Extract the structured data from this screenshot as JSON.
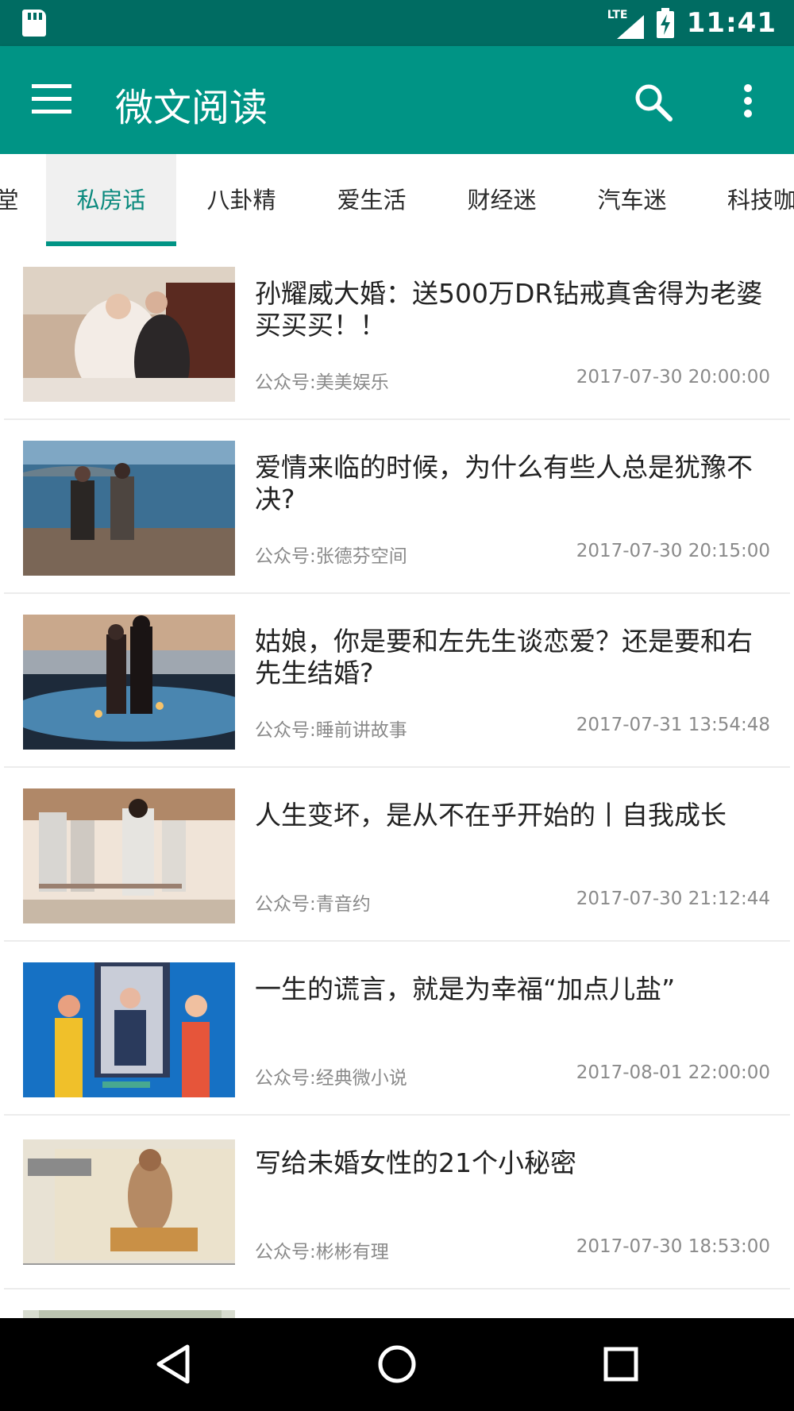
{
  "status_bar": {
    "network": "LTE",
    "time": "11:41"
  },
  "app_bar": {
    "title": "微文阅读",
    "menu_icon": "hamburger-menu-icon",
    "search_icon": "search-icon",
    "more_icon": "more-vert-icon"
  },
  "tabs": [
    {
      "label": "堂",
      "active": false
    },
    {
      "label": "私房话",
      "active": true
    },
    {
      "label": "八卦精",
      "active": false
    },
    {
      "label": "爱生活",
      "active": false
    },
    {
      "label": "财经迷",
      "active": false
    },
    {
      "label": "汽车迷",
      "active": false
    },
    {
      "label": "科技咖",
      "active": false
    }
  ],
  "articles": [
    {
      "title": "孙耀威大婚：送500万DR钻戒真舍得为老婆买买买！！",
      "source": "公众号:美美娱乐",
      "date": "2017-07-30 20:00:00"
    },
    {
      "title": "爱情来临的时候，为什么有些人总是犹豫不决?",
      "source": "公众号:张德芬空间",
      "date": "2017-07-30 20:15:00"
    },
    {
      "title": "姑娘，你是要和左先生谈恋爱？还是要和右先生结婚?",
      "source": "公众号:睡前讲故事",
      "date": "2017-07-31 13:54:48"
    },
    {
      "title": "人生变坏，是从不在乎开始的丨自我成长",
      "source": "公众号:青音约",
      "date": "2017-07-30 21:12:44"
    },
    {
      "title": "一生的谎言，就是为幸福“加点儿盐”",
      "source": "公众号:经典微小说",
      "date": "2017-08-01 22:00:00"
    },
    {
      "title": "写给未婚女性的21个小秘密",
      "source": "公众号:彬彬有理",
      "date": "2017-07-30 18:53:00"
    }
  ],
  "nav_bar": {
    "back_icon": "back-icon",
    "home_icon": "home-icon",
    "recents_icon": "recents-icon"
  },
  "colors": {
    "status_bar": "#006c62",
    "app_bar": "#009485",
    "accent": "#009485",
    "nav_bar": "#000000"
  }
}
